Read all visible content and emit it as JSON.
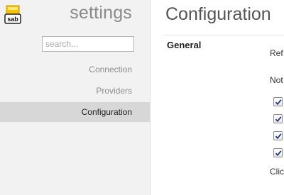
{
  "sidebar": {
    "logo_text": "sab",
    "title": "settings",
    "search": {
      "placeholder": "search...",
      "value": ""
    },
    "items": [
      {
        "label": "Connection",
        "active": false
      },
      {
        "label": "Providers",
        "active": false
      },
      {
        "label": "Configuration",
        "active": true
      }
    ]
  },
  "main": {
    "title": "Configuration",
    "section": "General",
    "text_fragments": [
      "Ref",
      "Not",
      "Clic"
    ],
    "checkboxes": [
      {
        "checked": true
      },
      {
        "checked": true
      },
      {
        "checked": true
      },
      {
        "checked": true
      }
    ]
  },
  "colors": {
    "sidebar_bg": "#f2f2f2",
    "active_item_bg": "#d7d7d7",
    "logo_yellow": "#f5c400"
  }
}
